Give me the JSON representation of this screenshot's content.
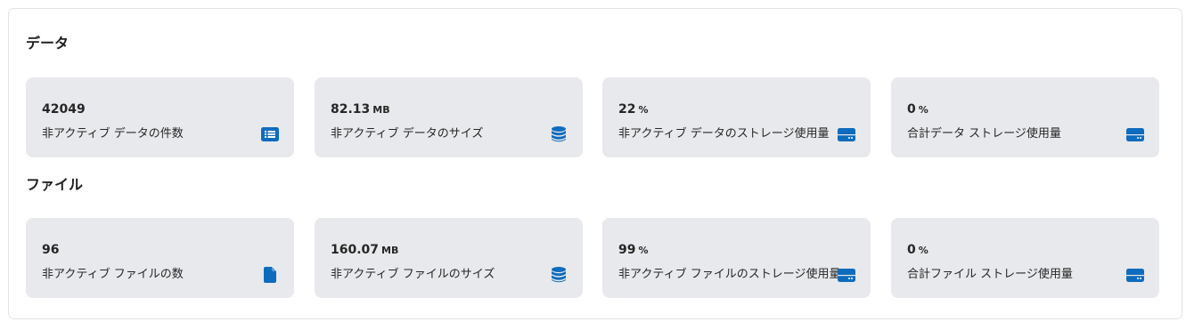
{
  "sections": [
    {
      "title": "データ",
      "cards": [
        {
          "value": "42049",
          "unit": "",
          "label": "非アクティブ データの件数",
          "icon": "list-icon"
        },
        {
          "value": "82.13",
          "unit": "MB",
          "label": "非アクティブ データのサイズ",
          "icon": "database-icon"
        },
        {
          "value": "22",
          "unit": "%",
          "label": "非アクティブ データのストレージ使用量",
          "icon": "storage-drive-icon"
        },
        {
          "value": "0",
          "unit": "%",
          "label": "合計データ ストレージ使用量",
          "icon": "storage-drive-icon"
        }
      ]
    },
    {
      "title": "ファイル",
      "cards": [
        {
          "value": "96",
          "unit": "",
          "label": "非アクティブ ファイルの数",
          "icon": "file-icon"
        },
        {
          "value": "160.07",
          "unit": "MB",
          "label": "非アクティブ ファイルのサイズ",
          "icon": "database-icon"
        },
        {
          "value": "99",
          "unit": "%",
          "label": "非アクティブ ファイルのストレージ使用量",
          "icon": "storage-drive-icon"
        },
        {
          "value": "0",
          "unit": "%",
          "label": "合計ファイル ストレージ使用量",
          "icon": "storage-drive-icon"
        }
      ]
    }
  ],
  "colors": {
    "icon": "#0f6cbd",
    "card_background": "#e8e9ec",
    "text": "#262626"
  }
}
